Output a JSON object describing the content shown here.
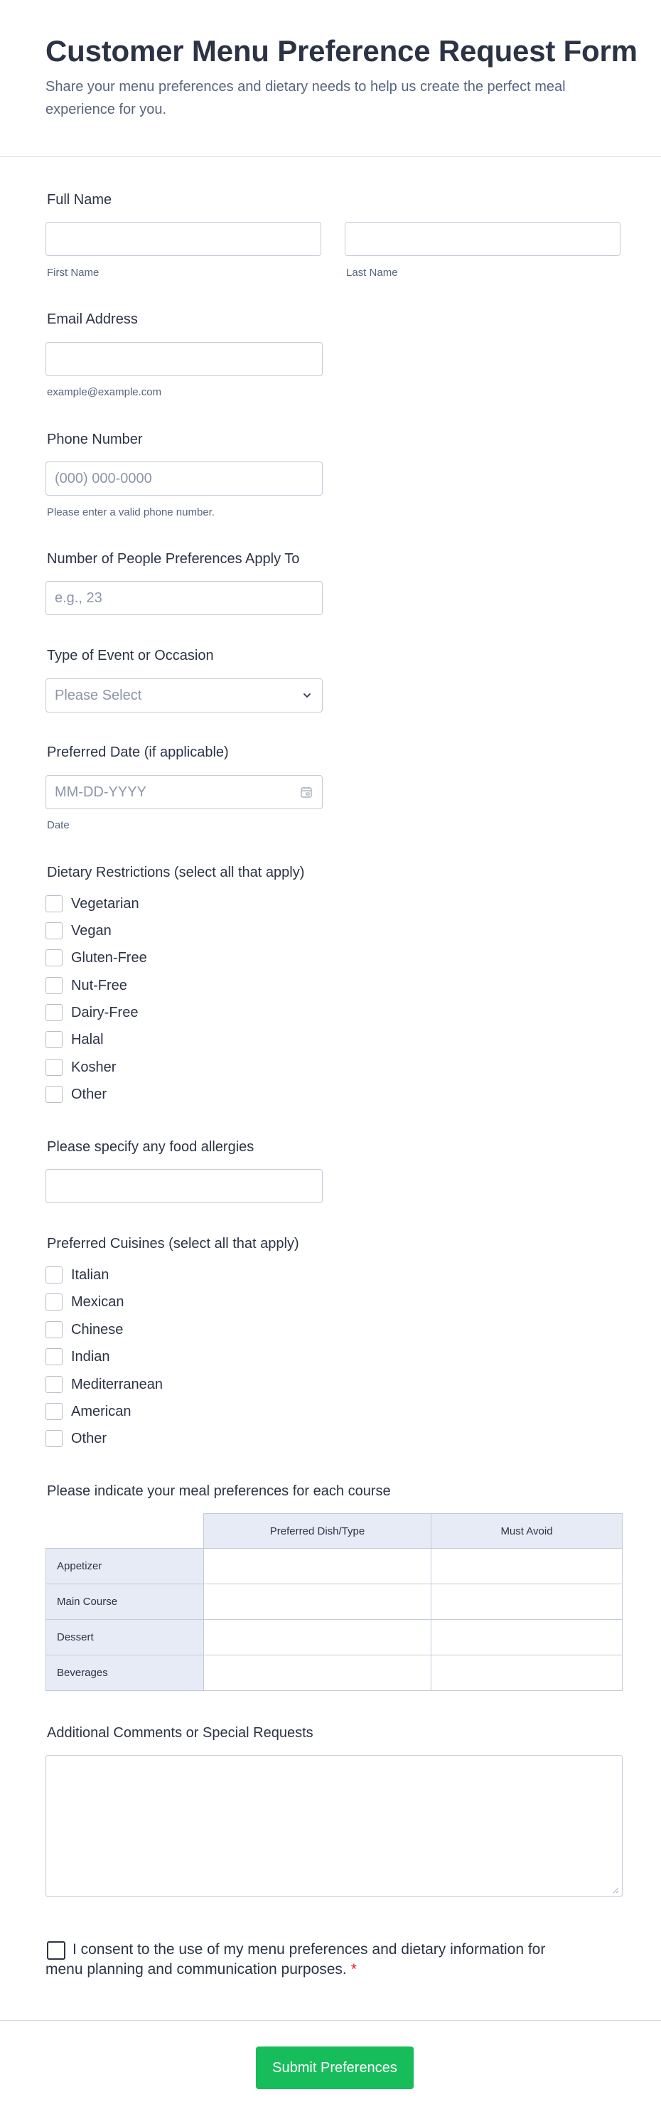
{
  "header": {
    "title": "Customer Menu Preference Request Form",
    "subtitle": "Share your menu preferences and dietary needs to help us create the perfect meal experience for you."
  },
  "full_name": {
    "label": "Full Name",
    "first_sublabel": "First Name",
    "last_sublabel": "Last Name",
    "first_value": "",
    "last_value": ""
  },
  "email": {
    "label": "Email Address",
    "sublabel": "example@example.com",
    "value": ""
  },
  "phone": {
    "label": "Phone Number",
    "placeholder": "(000) 000-0000",
    "sublabel": "Please enter a valid phone number."
  },
  "people": {
    "label": "Number of People Preferences Apply To",
    "placeholder": "e.g., 23"
  },
  "event": {
    "label": "Type of Event or Occasion",
    "selected": "Please Select"
  },
  "date": {
    "label": "Preferred Date (if applicable)",
    "placeholder": "MM-DD-YYYY",
    "sublabel": "Date"
  },
  "dietary": {
    "label": "Dietary Restrictions (select all that apply)",
    "options": [
      "Vegetarian",
      "Vegan",
      "Gluten-Free",
      "Nut-Free",
      "Dairy-Free",
      "Halal",
      "Kosher",
      "Other"
    ]
  },
  "allergies": {
    "label": "Please specify any food allergies",
    "value": ""
  },
  "cuisines": {
    "label": "Preferred Cuisines (select all that apply)",
    "options": [
      "Italian",
      "Mexican",
      "Chinese",
      "Indian",
      "Mediterranean",
      "American",
      "Other"
    ]
  },
  "matrix": {
    "label": "Please indicate your meal preferences for each course",
    "columns": [
      "Preferred Dish/Type",
      "Must Avoid"
    ],
    "rows": [
      "Appetizer",
      "Main Course",
      "Dessert",
      "Beverages"
    ]
  },
  "comments": {
    "label": "Additional Comments or Special Requests",
    "value": ""
  },
  "consent": {
    "text": "I consent to the use of my menu preferences and dietary information for menu planning and communication purposes.",
    "required_mark": "*"
  },
  "submit": {
    "label": "Submit Preferences"
  },
  "colors": {
    "accent": "#18bd5b",
    "required": "#e0212f",
    "text": "#2c3345",
    "muted": "#57647e",
    "matrix_header_bg": "#e6ebf6"
  },
  "icons": {
    "select": "chevron-down-icon",
    "date": "calendar-icon"
  }
}
